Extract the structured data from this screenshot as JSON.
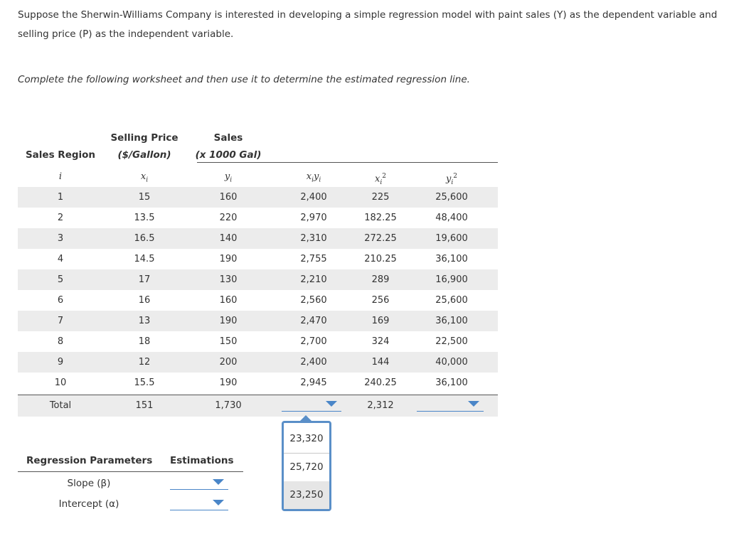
{
  "intro": "Suppose the Sherwin-Williams Company is interested in developing a simple regression model with paint sales (Y) as the dependent variable and selling price (P) as the independent variable.",
  "instruction": "Complete the following worksheet and then use it to determine the estimated regression line.",
  "worksheet": {
    "headers": {
      "region": "Sales Region",
      "price_top": "Selling Price",
      "price_unit": "($/Gallon)",
      "sales_top": "Sales",
      "sales_unit": "(x 1000 Gal)"
    },
    "symbols": {
      "i": "i",
      "x": "x",
      "y": "y",
      "sub": "i",
      "sq": "2"
    },
    "rows": [
      {
        "i": "1",
        "x": "15",
        "y": "160",
        "xy": "2,400",
        "x2": "225",
        "y2": "25,600"
      },
      {
        "i": "2",
        "x": "13.5",
        "y": "220",
        "xy": "2,970",
        "x2": "182.25",
        "y2": "48,400"
      },
      {
        "i": "3",
        "x": "16.5",
        "y": "140",
        "xy": "2,310",
        "x2": "272.25",
        "y2": "19,600"
      },
      {
        "i": "4",
        "x": "14.5",
        "y": "190",
        "xy": "2,755",
        "x2": "210.25",
        "y2": "36,100"
      },
      {
        "i": "5",
        "x": "17",
        "y": "130",
        "xy": "2,210",
        "x2": "289",
        "y2": "16,900"
      },
      {
        "i": "6",
        "x": "16",
        "y": "160",
        "xy": "2,560",
        "x2": "256",
        "y2": "25,600"
      },
      {
        "i": "7",
        "x": "13",
        "y": "190",
        "xy": "2,470",
        "x2": "169",
        "y2": "36,100"
      },
      {
        "i": "8",
        "x": "18",
        "y": "150",
        "xy": "2,700",
        "x2": "324",
        "y2": "22,500"
      },
      {
        "i": "9",
        "x": "12",
        "y": "200",
        "xy": "2,400",
        "x2": "144",
        "y2": "40,000"
      },
      {
        "i": "10",
        "x": "15.5",
        "y": "190",
        "xy": "2,945",
        "x2": "240.25",
        "y2": "36,100"
      }
    ],
    "total": {
      "label": "Total",
      "x": "151",
      "y": "1,730",
      "x2": "2,312"
    }
  },
  "dropdown_options": [
    "23,320",
    "25,720",
    "23,250"
  ],
  "params": {
    "header_left": "Regression Parameters",
    "header_right": "Estimations",
    "slope_label": "Slope (β)",
    "intercept_label": "Intercept (α)"
  },
  "colors": {
    "accent": "#4a86c8",
    "row_shade": "#ececec"
  }
}
